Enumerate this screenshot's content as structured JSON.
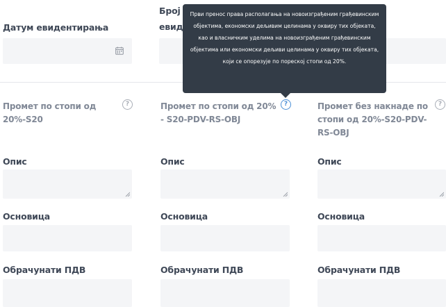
{
  "top": {
    "date_label": "Датум евидентирања",
    "number_label_line1": "Број П",
    "number_label_line2": "евид"
  },
  "tooltip": {
    "text": "Први пренос права располагања на новоизграђеним грађевинским објектима, економски дељивим целинама у оквиру тих објеката, као и власничким уделима на новоизграђеним грађевинским објектима или економски дељиви целинама у оквиру тих објеката, који се опорезује по пореској стопи од 20%."
  },
  "columns": [
    {
      "heading_line1": "Промет по стопи од",
      "heading_line2": "20%-S20",
      "heading_line3": "",
      "description_label": "Опис",
      "base_label": "Основица",
      "vat_label": "Обрачунати ПДВ"
    },
    {
      "heading_line1": "Промет по стопи од 20%",
      "heading_line2": "- S20-PDV-RS-OBJ",
      "heading_line3": "",
      "description_label": "Опис",
      "base_label": "Основица",
      "vat_label": "Обрачунати ПДВ"
    },
    {
      "heading_line1": "Промет без накнаде по",
      "heading_line2": "стопи од 20%-S20-PDV-",
      "heading_line3": "RS-OBJ",
      "description_label": "Опис",
      "base_label": "Основица",
      "vat_label": "Обрачунати ПДВ"
    }
  ],
  "icons": {
    "help": "?",
    "calendar": "calendar-icon"
  },
  "colors": {
    "tooltip_bg": "#333c47",
    "help_active": "#4a8fd6",
    "field_bg": "#f4f5f7"
  }
}
